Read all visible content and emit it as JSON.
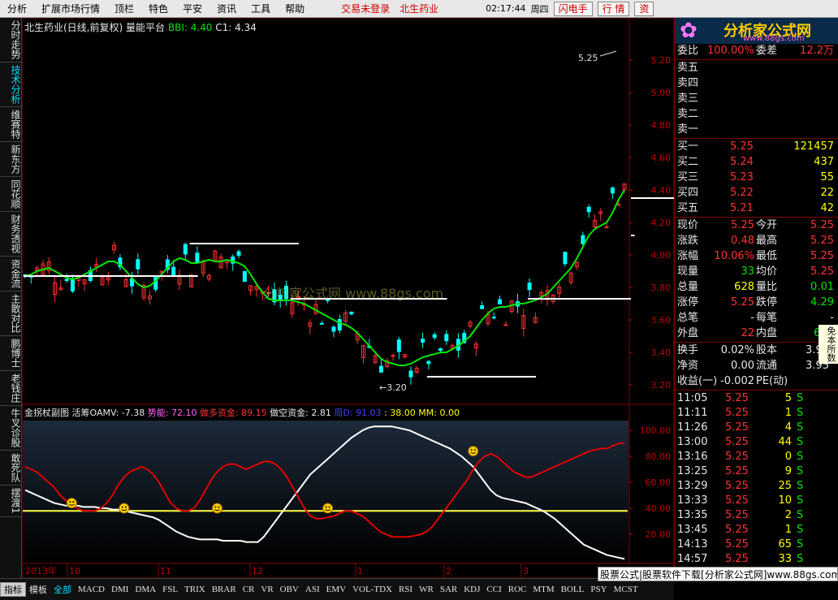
{
  "menubar": {
    "items": [
      "分析",
      "扩展市场行情",
      "顶栏",
      "特色",
      "平安",
      "资讯",
      "工具",
      "帮助"
    ],
    "status": "交易未登录",
    "stock": "北生药业",
    "clock": "02:17:44",
    "weekday": "周四",
    "buttons": [
      "闪电手",
      "行 情",
      "资"
    ]
  },
  "logo": {
    "main": "分析家公式网",
    "sub": "www.88gs.com",
    "flower": "✿"
  },
  "vtabs": [
    {
      "label": "分时走势",
      "active": false
    },
    {
      "label": "技术分析",
      "active": true
    },
    {
      "label": "维赛特",
      "active": false
    },
    {
      "label": "新东方",
      "active": false
    },
    {
      "label": "同花顺",
      "active": false
    },
    {
      "label": "财务透视",
      "active": false
    },
    {
      "label": "资金流",
      "active": false
    },
    {
      "label": "主散对比",
      "active": false
    },
    {
      "label": "鹏博士",
      "active": false
    },
    {
      "label": "老钱庄",
      "active": false
    },
    {
      "label": "牛叉诊股",
      "active": false
    },
    {
      "label": "敢死队",
      "active": false
    },
    {
      "label": "摆渡1",
      "active": false
    }
  ],
  "main": {
    "title_name": "北生药业(日线,前复权)",
    "title_formula": "量能平台",
    "bbi_label": "BBI: 4.40",
    "c1_label": "C1: 4.34",
    "watermark": "分析家公式网 www.88gs.com",
    "annotation_high": "5.25",
    "annotation_low": "←3.20"
  },
  "sub": {
    "name": "金拐杖副图",
    "oamv": "活筹OAMV: -7.38",
    "shineng": "势能: 72.10",
    "duo": "做多资金: 89.15",
    "kong": "做空资金: 2.81",
    "zhou": "周D: 91.03",
    "n38": ": 38.00",
    "mm": "MM: 0.00"
  },
  "xaxis": {
    "year": "2013年",
    "months": [
      "10",
      "11",
      "12",
      "1",
      "2",
      "3"
    ],
    "tail": "日线"
  },
  "chart_data": [
    {
      "type": "candlestick",
      "title": "北生药业(日线,前复权) 量能平台",
      "y_ticks": [
        5.2,
        5.0,
        4.8,
        4.6,
        4.4,
        4.2,
        4.0,
        3.8,
        3.6,
        3.4,
        3.2
      ],
      "ylim": [
        3.15,
        5.32
      ],
      "series": [
        {
          "name": "BBI",
          "color": "#00e600",
          "values": [
            3.87,
            3.88,
            3.9,
            3.91,
            3.92,
            3.9,
            3.88,
            3.86,
            3.85,
            3.86,
            3.88,
            3.9,
            3.92,
            3.94,
            3.96,
            3.96,
            3.94,
            3.9,
            3.86,
            3.82,
            3.8,
            3.81,
            3.84,
            3.88,
            3.92,
            3.96,
            3.98,
            3.97,
            3.95,
            3.95,
            3.96,
            3.97,
            3.96,
            3.96,
            3.97,
            3.96,
            3.95,
            3.93,
            3.88,
            3.82,
            3.77,
            3.73,
            3.72,
            3.72,
            3.72,
            3.72,
            3.71,
            3.7,
            3.68,
            3.66,
            3.64,
            3.62,
            3.6,
            3.58,
            3.57,
            3.55,
            3.52,
            3.48,
            3.44,
            3.4,
            3.36,
            3.34,
            3.33,
            3.32,
            3.32,
            3.33,
            3.35,
            3.37,
            3.38,
            3.39,
            3.4,
            3.4,
            3.42,
            3.44,
            3.47,
            3.5,
            3.55,
            3.6,
            3.64,
            3.67,
            3.68,
            3.68,
            3.69,
            3.7,
            3.7,
            3.71,
            3.72,
            3.74,
            3.76,
            3.8,
            3.84,
            3.88,
            3.92,
            3.98,
            4.05,
            4.12,
            4.16,
            4.18,
            4.2,
            4.26,
            4.34,
            4.4
          ]
        },
        {
          "name": "平台线",
          "color": "#ffffff"
        }
      ],
      "platforms": [
        [
          0,
          28,
          3.87
        ],
        [
          28,
          45,
          4.07
        ],
        [
          45,
          70,
          3.73
        ],
        [
          68,
          85,
          3.25
        ],
        [
          85,
          110,
          3.73
        ],
        [
          103,
          112,
          4.12
        ],
        [
          112,
          118,
          4.35
        ]
      ],
      "annotations": [
        {
          "text": "5.25"
        },
        {
          "text": "←3.20"
        }
      ]
    },
    {
      "type": "line",
      "title": "金拐杖副图",
      "y_ticks": [
        100.0,
        80.0,
        60.0,
        40.0,
        20.0
      ],
      "ylim": [
        0,
        105
      ],
      "series": [
        {
          "name": "做多资金",
          "color": "#e00000",
          "values": [
            72,
            70,
            68,
            64,
            60,
            56,
            50,
            46,
            42,
            40,
            38,
            38,
            38,
            40,
            44,
            50,
            58,
            64,
            68,
            70,
            72,
            70,
            66,
            60,
            52,
            44,
            40,
            38,
            38,
            40,
            46,
            54,
            62,
            68,
            72,
            74,
            74,
            72,
            70,
            72,
            74,
            76,
            76,
            74,
            70,
            64,
            56,
            48,
            40,
            34,
            32,
            32,
            33,
            34,
            36,
            38,
            38,
            36,
            34,
            30,
            26,
            22,
            20,
            18,
            18,
            18,
            18,
            19,
            20,
            22,
            26,
            32,
            38,
            44,
            50,
            56,
            62,
            70,
            76,
            80,
            82,
            80,
            76,
            72,
            68,
            66,
            64,
            64,
            66,
            68,
            70,
            72,
            74,
            76,
            78,
            80,
            82,
            84,
            85,
            86,
            86,
            88,
            90,
            90
          ]
        },
        {
          "name": "周D",
          "color": "#ffffff",
          "values": [
            54,
            52,
            50,
            48,
            46,
            44,
            43,
            42,
            42,
            42,
            41,
            41,
            41,
            40,
            40,
            39,
            39,
            38,
            37,
            36,
            35,
            34,
            33,
            31,
            28,
            25,
            22,
            20,
            18,
            17,
            16,
            16,
            16,
            16,
            15,
            15,
            15,
            15,
            14,
            14,
            14,
            18,
            24,
            30,
            36,
            42,
            48,
            54,
            60,
            66,
            70,
            74,
            78,
            82,
            86,
            90,
            94,
            97,
            100,
            102,
            103,
            103,
            103,
            103,
            102,
            101,
            100,
            98,
            96,
            94,
            92,
            90,
            88,
            86,
            83,
            80,
            76,
            72,
            66,
            60,
            54,
            50,
            48,
            47,
            46,
            45,
            44,
            42,
            40,
            38,
            35,
            32,
            28,
            24,
            20,
            16,
            12,
            10,
            8,
            6,
            4,
            3,
            2,
            1
          ]
        },
        {
          "name": "参考线",
          "color": "#ffff40",
          "values": [
            38
          ]
        }
      ]
    }
  ],
  "quote": {
    "header": [
      {
        "label": "委比",
        "value": "100.00%",
        "label2": "委差",
        "value2": "12.2万"
      }
    ],
    "sell": [
      {
        "label": "卖五"
      },
      {
        "label": "卖四"
      },
      {
        "label": "卖三"
      },
      {
        "label": "卖二"
      },
      {
        "label": "卖一"
      }
    ],
    "buy": [
      {
        "label": "买一",
        "price": "5.25",
        "vol": "121457"
      },
      {
        "label": "买二",
        "price": "5.24",
        "vol": "437"
      },
      {
        "label": "买三",
        "price": "5.23",
        "vol": "55"
      },
      {
        "label": "买四",
        "price": "5.22",
        "vol": "22"
      },
      {
        "label": "买五",
        "price": "5.21",
        "vol": "42"
      }
    ],
    "stats": [
      {
        "l1": "现价",
        "v1": "5.25",
        "c1": "red",
        "l2": "今开",
        "v2": "5.25",
        "c2": "red"
      },
      {
        "l1": "涨跌",
        "v1": "0.48",
        "c1": "red",
        "l2": "最高",
        "v2": "5.25",
        "c2": "red"
      },
      {
        "l1": "涨幅",
        "v1": "10.06%",
        "c1": "red",
        "l2": "最低",
        "v2": "5.25",
        "c2": "red"
      },
      {
        "l1": "现量",
        "v1": "33",
        "c1": "green",
        "l2": "均价",
        "v2": "5.25",
        "c2": "red"
      },
      {
        "l1": "总量",
        "v1": "628",
        "c1": "yellow",
        "l2": "量比",
        "v2": "0.01",
        "c2": "green"
      },
      {
        "l1": "涨停",
        "v1": "5.25",
        "c1": "red",
        "l2": "跌停",
        "v2": "4.29",
        "c2": "green"
      },
      {
        "l1": "总笔",
        "v1": "-",
        "c1": "white",
        "l2": "每笔",
        "v2": "-",
        "c2": "white"
      },
      {
        "l1": "外盘",
        "v1": "22",
        "c1": "red",
        "l2": "内盘",
        "v2": "606",
        "c2": "green"
      }
    ],
    "fund": [
      {
        "l1": "换手",
        "v1": "0.02%",
        "l2": "股本",
        "v2": "3.95"
      },
      {
        "l1": "净资",
        "v1": "0.00",
        "l2": "流通",
        "v2": "3.95"
      },
      {
        "l1": "收益(一)",
        "v1": "-0.002",
        "l2": "PE(动)",
        "v2": ""
      }
    ],
    "ticks": [
      {
        "time": "11:05",
        "price": "5.25",
        "vol": "5",
        "bs": "S"
      },
      {
        "time": "11:11",
        "price": "5.25",
        "vol": "1",
        "bs": "S"
      },
      {
        "time": "11:26",
        "price": "5.25",
        "vol": "4",
        "bs": "S"
      },
      {
        "time": "13:00",
        "price": "5.25",
        "vol": "44",
        "bs": "S"
      },
      {
        "time": "13:16",
        "price": "5.25",
        "vol": "0",
        "bs": "S"
      },
      {
        "time": "13:25",
        "price": "5.25",
        "vol": "9",
        "bs": "S"
      },
      {
        "time": "13:29",
        "price": "5.25",
        "vol": "25",
        "bs": "S"
      },
      {
        "time": "13:33",
        "price": "5.25",
        "vol": "10",
        "bs": "S"
      },
      {
        "time": "13:35",
        "price": "5.25",
        "vol": "2",
        "bs": "S"
      },
      {
        "time": "13:45",
        "price": "5.25",
        "vol": "1",
        "bs": "S"
      },
      {
        "time": "14:13",
        "price": "5.25",
        "vol": "65",
        "bs": "S"
      },
      {
        "time": "14:57",
        "price": "5.25",
        "vol": "33",
        "bs": "S"
      }
    ],
    "side_note": "免本所数"
  },
  "bottom_tabs": [
    "指标",
    "模板",
    "全部",
    "MACD",
    "DMI",
    "DMA",
    "FSL",
    "TRIX",
    "BRAR",
    "CR",
    "VR",
    "OBV",
    "ASI",
    "EMV",
    "VOL-TDX",
    "RSI",
    "WR",
    "SAR",
    "KDJ",
    "CCI",
    "ROC",
    "MTM",
    "BOLL",
    "PSY",
    "MCST"
  ],
  "promo": "股票公式|股票软件下载[分析家公式网]www.88gs.com"
}
